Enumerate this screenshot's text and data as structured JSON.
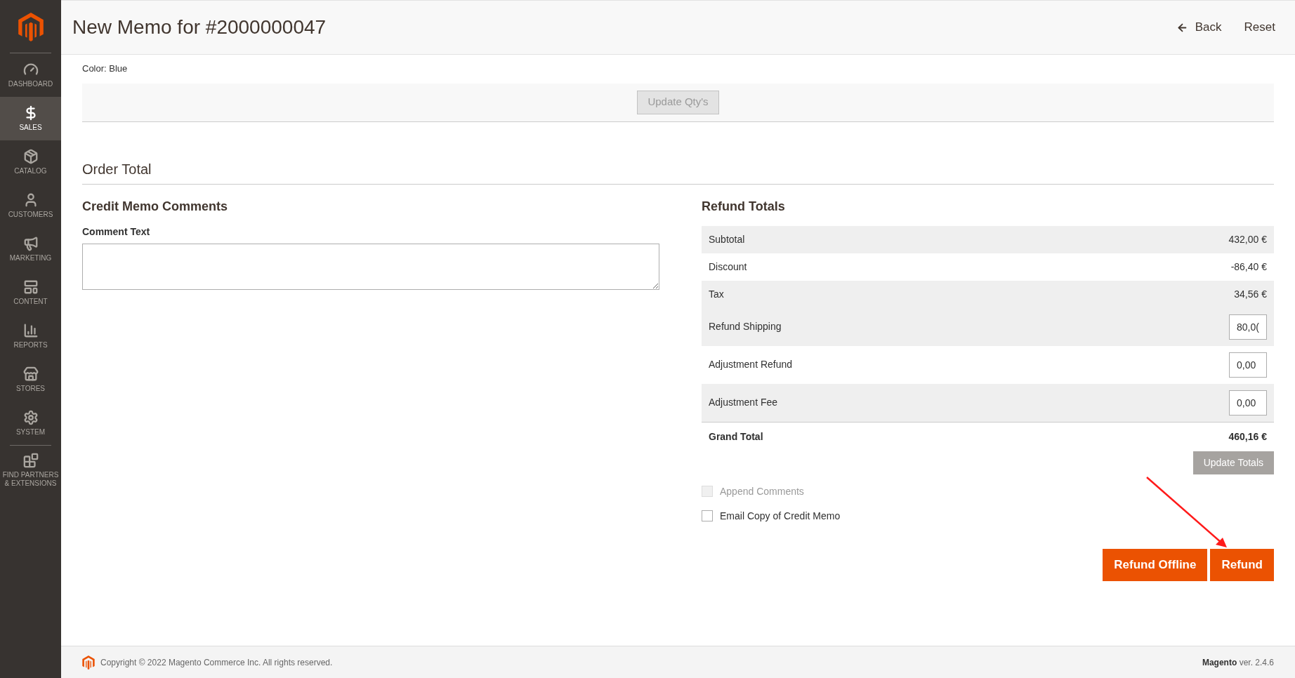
{
  "sidebar": {
    "items": [
      {
        "kind": "dashboard",
        "label": "DASHBOARD",
        "selected": false
      },
      {
        "kind": "sales",
        "label": "SALES",
        "selected": true
      },
      {
        "kind": "catalog",
        "label": "CATALOG",
        "selected": false
      },
      {
        "kind": "customers",
        "label": "CUSTOMERS",
        "selected": false
      },
      {
        "kind": "marketing",
        "label": "MARKETING",
        "selected": false
      },
      {
        "kind": "content",
        "label": "CONTENT",
        "selected": false
      },
      {
        "kind": "reports",
        "label": "REPORTS",
        "selected": false
      },
      {
        "kind": "stores",
        "label": "STORES",
        "selected": false
      },
      {
        "kind": "system",
        "label": "SYSTEM",
        "selected": false
      },
      {
        "kind": "partners",
        "label": "FIND PARTNERS & EXTENSIONS",
        "selected": false
      }
    ]
  },
  "header": {
    "title": "New Memo for #2000000047",
    "back": "Back",
    "reset": "Reset"
  },
  "item_option": {
    "label": "Color:",
    "value": "Blue"
  },
  "update_qty_button": "Update Qty's",
  "section_title": "Order Total",
  "comments": {
    "title": "Credit Memo Comments",
    "label": "Comment Text"
  },
  "refund_totals": {
    "title": "Refund Totals",
    "rows": [
      {
        "kind": "text",
        "label": "Subtotal",
        "value": "432,00 €",
        "shaded": true
      },
      {
        "kind": "text",
        "label": "Discount",
        "value": "-86,40 €",
        "shaded": false
      },
      {
        "kind": "text",
        "label": "Tax",
        "value": "34,56 €",
        "shaded": true
      },
      {
        "kind": "input",
        "label": "Refund Shipping",
        "value": "80,0(",
        "shaded": true
      },
      {
        "kind": "input",
        "label": "Adjustment Refund",
        "value": "0,00",
        "shaded": false
      },
      {
        "kind": "input",
        "label": "Adjustment Fee",
        "value": "0,00",
        "shaded": true
      }
    ],
    "grand_total": {
      "label": "Grand Total",
      "value": "460,16 €"
    },
    "update_button": "Update Totals",
    "options": [
      {
        "label": "Append Comments",
        "checked": false,
        "disabled": true
      },
      {
        "label": "Email Copy of Credit Memo",
        "checked": false,
        "disabled": false
      }
    ],
    "buttons": [
      "Refund Offline",
      "Refund"
    ]
  },
  "footer": {
    "copyright": "Copyright © 2022 Magento Commerce Inc. All rights reserved.",
    "brand": "Magento",
    "version": "ver. 2.4.6"
  }
}
